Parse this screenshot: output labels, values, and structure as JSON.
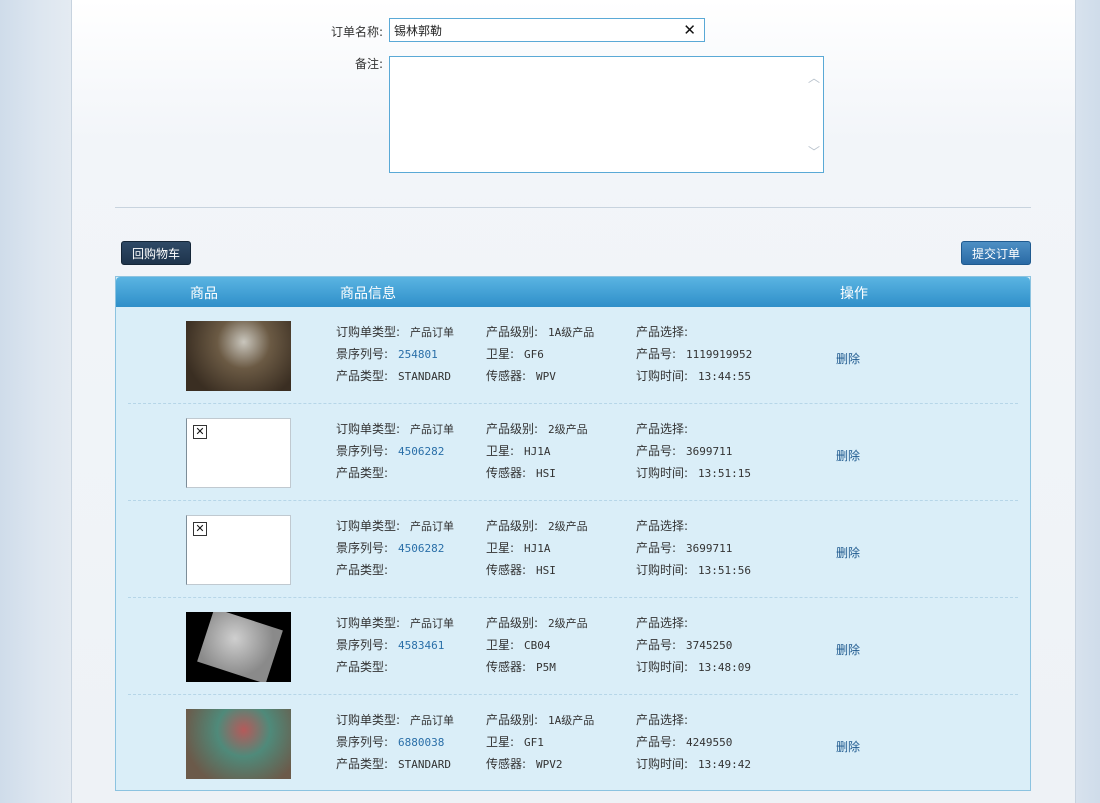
{
  "form": {
    "order_name_label": "订单名称:",
    "order_name_value": "锡林郭勒",
    "clear_symbol": "✕",
    "remark_label": "备注:",
    "remark_value": ""
  },
  "buttons": {
    "back_to_cart": "回购物车",
    "submit_order": "提交订单"
  },
  "table": {
    "headers": [
      "商品",
      "商品信息",
      "操作"
    ],
    "field_labels": {
      "order_type": "订购单类型:",
      "scene_no": "景序列号:",
      "product_type": "产品类型:",
      "product_level": "产品级别:",
      "satellite": "卫星:",
      "sensor": "传感器:",
      "product_select": "产品选择:",
      "product_id": "产品号:",
      "order_time": "订购时间:"
    },
    "rows": [
      {
        "thumb": "image",
        "thumb_colors": [
          "#3a2e22",
          "#6b5a44",
          "#c9c6bd"
        ],
        "order_type": "产品订单",
        "scene_no": "254801",
        "product_type": "STANDARD",
        "product_level": "1A级产品",
        "satellite": "GF6",
        "sensor": "WPV",
        "product_select": "",
        "product_id": "1119919952",
        "order_time": "13:44:55",
        "delete": "删除"
      },
      {
        "thumb": "broken",
        "order_type": "产品订单",
        "scene_no": "4506282",
        "product_type": "",
        "product_level": "2级产品",
        "satellite": "HJ1A",
        "sensor": "HSI",
        "product_select": "",
        "product_id": "3699711",
        "order_time": "13:51:15",
        "delete": "删除"
      },
      {
        "thumb": "broken",
        "order_type": "产品订单",
        "scene_no": "4506282",
        "product_type": "",
        "product_level": "2级产品",
        "satellite": "HJ1A",
        "sensor": "HSI",
        "product_select": "",
        "product_id": "3699711",
        "order_time": "13:51:56",
        "delete": "删除"
      },
      {
        "thumb": "image",
        "thumb_colors": [
          "#000000",
          "#8a8a8a",
          "#cfcfcf"
        ],
        "order_type": "产品订单",
        "scene_no": "4583461",
        "product_type": "",
        "product_level": "2级产品",
        "satellite": "CB04",
        "sensor": "P5M",
        "product_select": "",
        "product_id": "3745250",
        "order_time": "13:48:09",
        "delete": "删除"
      },
      {
        "thumb": "image",
        "thumb_colors": [
          "#6b5a4a",
          "#4f8a7a",
          "#b55a5a"
        ],
        "order_type": "产品订单",
        "scene_no": "6880038",
        "product_type": "STANDARD",
        "product_level": "1A级产品",
        "satellite": "GF1",
        "sensor": "WPV2",
        "product_select": "",
        "product_id": "4249550",
        "order_time": "13:49:42",
        "delete": "删除"
      }
    ]
  }
}
